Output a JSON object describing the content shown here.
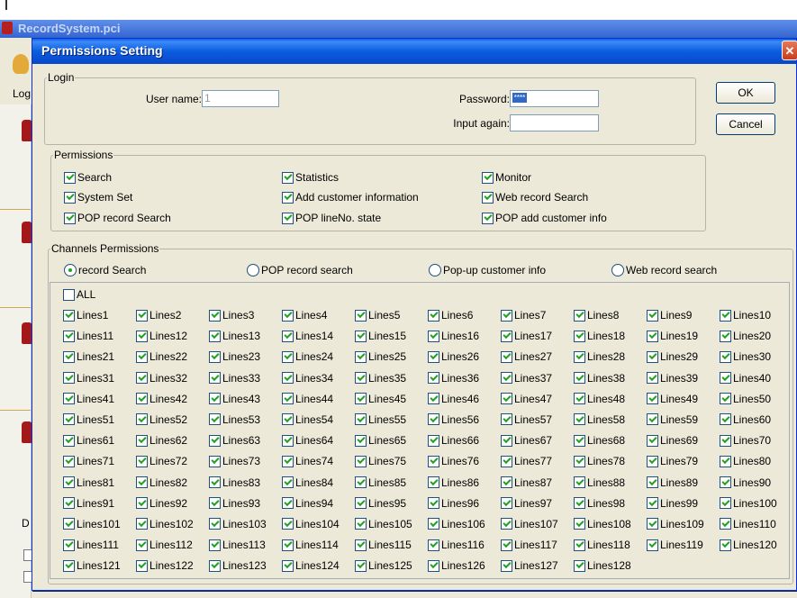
{
  "background_app": {
    "title": "RecordSystem.pci",
    "toolbar_label": "Log",
    "side_label": "D"
  },
  "dialog": {
    "title": "Permissions Setting",
    "close_glyph": "✕"
  },
  "login": {
    "legend": "Login",
    "user_name_label": "User name:",
    "user_name_value": "1",
    "password_label": "Password:",
    "password_value": "****",
    "input_again_label": "Input again:",
    "input_again_value": ""
  },
  "buttons": {
    "ok": "OK",
    "cancel": "Cancel"
  },
  "permissions": {
    "legend": "Permissions",
    "items": [
      {
        "label": "Search",
        "checked": true
      },
      {
        "label": "Statistics",
        "checked": true
      },
      {
        "label": "Monitor",
        "checked": true
      },
      {
        "label": "System Set",
        "checked": true
      },
      {
        "label": "Add customer information",
        "checked": true
      },
      {
        "label": "Web record Search",
        "checked": true
      },
      {
        "label": "POP record Search",
        "checked": true
      },
      {
        "label": "POP lineNo. state",
        "checked": true
      },
      {
        "label": "POP add customer info",
        "checked": true
      }
    ]
  },
  "channels": {
    "legend": "Channels Permissions",
    "modes": [
      {
        "label": "record Search",
        "selected": true
      },
      {
        "label": "POP record search",
        "selected": false
      },
      {
        "label": "Pop-up customer info",
        "selected": false
      },
      {
        "label": "Web record search",
        "selected": false
      }
    ],
    "all_label": "ALL",
    "all_checked": false,
    "line_prefix": "Lines",
    "line_count": 128,
    "lines_checked": true
  },
  "colors": {
    "title_bar": "#0b5de0",
    "dialog_bg": "#ece9d8",
    "check_mark": "#21a121",
    "close_button": "#c73c1c"
  }
}
